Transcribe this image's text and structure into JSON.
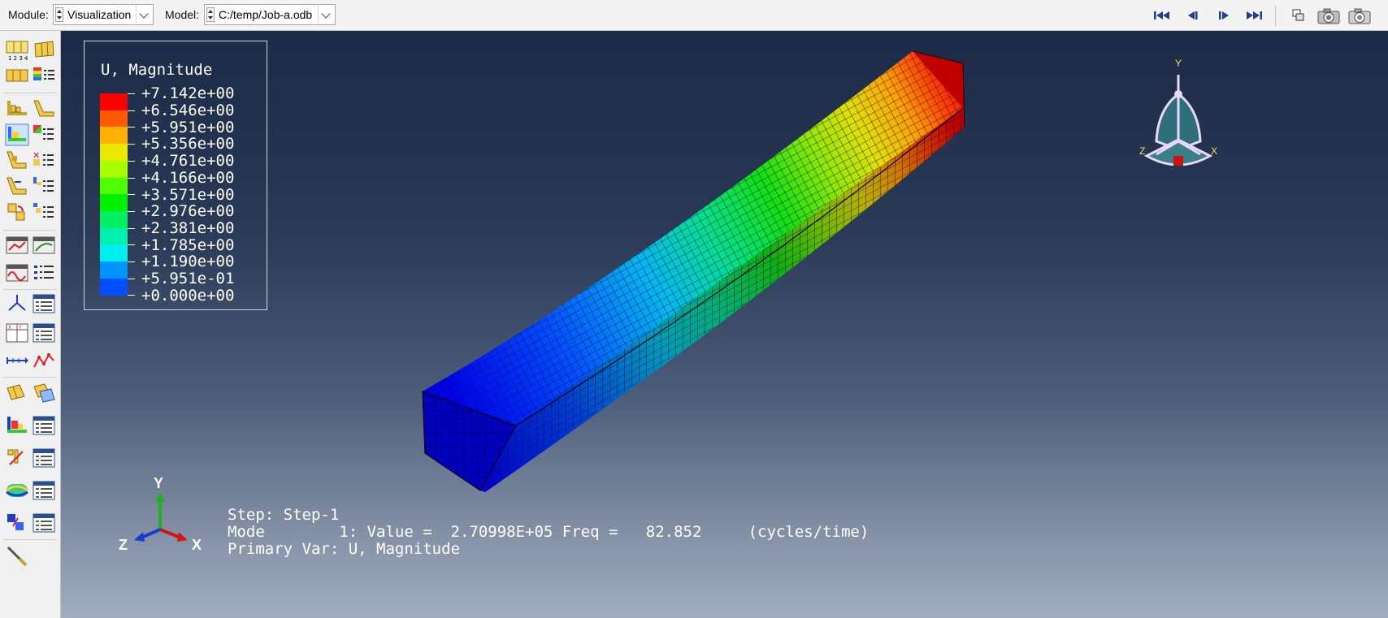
{
  "toolbar": {
    "module_label": "Module:",
    "module_value": "Visualization",
    "model_label": "Model:",
    "model_value": "C:/temp/Job-a.odb",
    "animation_buttons": [
      "first-frame-icon",
      "previous-frame-icon",
      "next-frame-icon",
      "last-frame-icon"
    ],
    "view_buttons": [
      "view-manager-icon",
      "camera-icon",
      "snapshot-icon"
    ]
  },
  "legend": {
    "title": "U, Magnitude",
    "values": [
      "+7.142e+00",
      "+6.546e+00",
      "+5.951e+00",
      "+5.356e+00",
      "+4.761e+00",
      "+4.166e+00",
      "+3.571e+00",
      "+2.976e+00",
      "+2.381e+00",
      "+1.785e+00",
      "+1.190e+00",
      "+5.951e-01",
      "+0.000e+00"
    ],
    "colors": [
      "#ff0000",
      "#ff5a00",
      "#ffb000",
      "#e8e800",
      "#a8ff00",
      "#50ff00",
      "#00f000",
      "#00f060",
      "#00f0b0",
      "#00f0f0",
      "#0094ff",
      "#0050ff",
      "#0000ff"
    ]
  },
  "status": {
    "step": "Step: Step-1",
    "mode": "Mode        1: Value =  2.70998E+05 Freq =   82.852     (cycles/time)",
    "primary_var": "Primary Var: U, Magnitude"
  },
  "triad": {
    "y": "Y",
    "z": "Z",
    "x": "X"
  },
  "orient": {
    "y": "Y",
    "z": "Z",
    "x": "X"
  },
  "colors": {
    "viewport_top": "#1b2a46",
    "viewport_bottom": "#a3adbf",
    "accent_axis_y": "#1fb21f",
    "accent_axis_x": "#d01818",
    "accent_axis_z": "#1a3ccf"
  }
}
